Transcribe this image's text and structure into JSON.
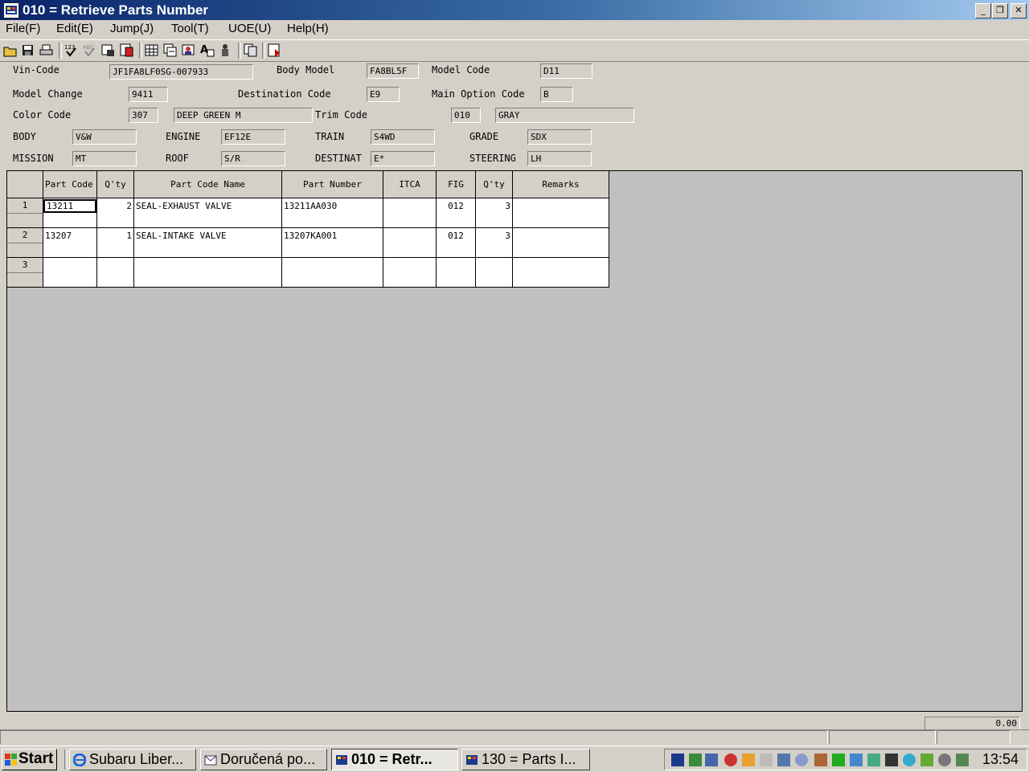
{
  "window": {
    "title": "010 = Retrieve Parts Number",
    "controls": {
      "minimize": "_",
      "restore": "❐",
      "close": "✕"
    }
  },
  "menu": [
    "File(F)",
    "Edit(E)",
    "Jump(J)",
    "Tool(T)",
    "UOE(U)",
    "Help(H)"
  ],
  "toolbar_icons": [
    "open-folder-icon",
    "save-icon",
    "print-icon",
    "numbering-icon",
    "check-icon",
    "export-icon",
    "copy-record-icon",
    "grid-icon",
    "window-copy-icon",
    "search-person-icon",
    "text-add-icon",
    "person-tool-icon",
    "copy-icon",
    "exit-icon"
  ],
  "header": {
    "vin_code_label": "Vin-Code",
    "vin_code": "JF1FA8LF0SG-007933",
    "body_model_label": "Body Model",
    "body_model": "FA8BL5F",
    "model_code_label": "Model Code",
    "model_code": "D11",
    "model_change_label": "Model Change",
    "model_change": "9411",
    "destination_code_label": "Destination Code",
    "destination_code": "E9",
    "main_option_code_label": "Main Option Code",
    "main_option_code": "B",
    "color_code_label": "Color Code",
    "color_code": "307",
    "color_name": "DEEP GREEN M",
    "trim_code_label": "Trim Code",
    "trim_code": "010",
    "trim_name": "GRAY",
    "body_label": "BODY",
    "body": "V&W",
    "engine_label": "ENGINE",
    "engine": "EF12E",
    "train_label": "TRAIN",
    "train": "S4WD",
    "grade_label": "GRADE",
    "grade": "SDX",
    "mission_label": "MISSION",
    "mission": "MT",
    "roof_label": "ROOF",
    "roof": "S/R",
    "destinat_label": "DESTINAT",
    "destinat": "E*",
    "steering_label": "STEERING",
    "steering": "LH"
  },
  "grid": {
    "columns": [
      "Part Code",
      "Q'ty",
      "Part Code Name",
      "Part Number",
      "ITCA",
      "FIG",
      "Q'ty",
      "Remarks"
    ],
    "rows": [
      {
        "num": "1",
        "part_code": "13211",
        "qty": "2",
        "name": "SEAL-EXHAUST VALVE",
        "part_number": "13211AA030",
        "itca": "",
        "fig": "012",
        "qty2": "3",
        "remarks": ""
      },
      {
        "num": "2",
        "part_code": "13207",
        "qty": "1",
        "name": "SEAL-INTAKE VALVE",
        "part_number": "13207KA001",
        "itca": "",
        "fig": "012",
        "qty2": "3",
        "remarks": ""
      },
      {
        "num": "3",
        "part_code": "",
        "qty": "",
        "name": "",
        "part_number": "",
        "itca": "",
        "fig": "",
        "qty2": "",
        "remarks": ""
      }
    ]
  },
  "status": {
    "total": "0.00"
  },
  "taskbar": {
    "start": "Start",
    "tasks": [
      "Subaru Liber...",
      "Doručená po...",
      "010 = Retr...",
      "130 = Parts I..."
    ],
    "clock": "13:54"
  }
}
